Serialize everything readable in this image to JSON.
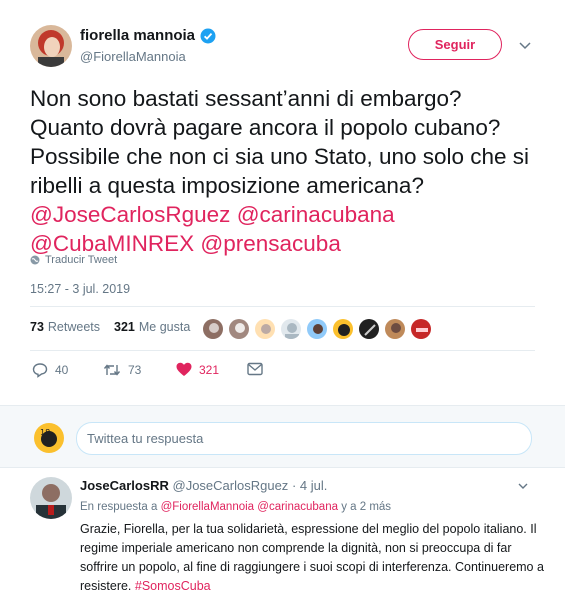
{
  "author": {
    "name": "fiorella mannoia",
    "handle": "@FiorellaMannoia",
    "follow_label": "Seguir"
  },
  "tweet": {
    "text_plain": "Non sono bastati sessant’anni di embargo? Quanto dovrà pagare ancora il popolo cubano? Possibile che non ci sia uno Stato, uno solo che si ribelli a questa imposizione americana?",
    "mention1": "@JoseCarlosRguez",
    "mention2": "@carinacubana",
    "mention3": "@CubaMINREX",
    "mention4": "@prensacuba",
    "translate_label": "Traducir Tweet",
    "timestamp": "15:27 - 3 jul. 2019"
  },
  "stats": {
    "retweets_count": "73",
    "retweets_label": "Retweets",
    "likes_count": "321",
    "likes_label": "Me gusta"
  },
  "actions": {
    "replies": "40",
    "retweets": "73",
    "likes": "321"
  },
  "reply_box": {
    "placeholder": "Twittea tu respuesta"
  },
  "reply": {
    "name": "JoseCarlosRR",
    "handle": "@JoseCarlosRguez",
    "date": "· 4 jul.",
    "in_reply_prefix": "En respuesta a",
    "in_reply_m1": "@FiorellaMannoia",
    "in_reply_m2": "@carinacubana",
    "in_reply_suffix": "y a 2 más",
    "body": "Grazie, Fiorella, per la tua solidarietà, espressione del meglio del popolo italiano. Il regime imperiale americano non comprende la dignità, non si preoccupa di far soffrire un popolo, al fine di raggiungere i suoi scopi di interferenza. Continueremo a resistere.",
    "hashtag": "#SomosCuba"
  },
  "colors": {
    "accent": "#e0245e",
    "muted": "#657786",
    "verified": "#1da1f2"
  }
}
